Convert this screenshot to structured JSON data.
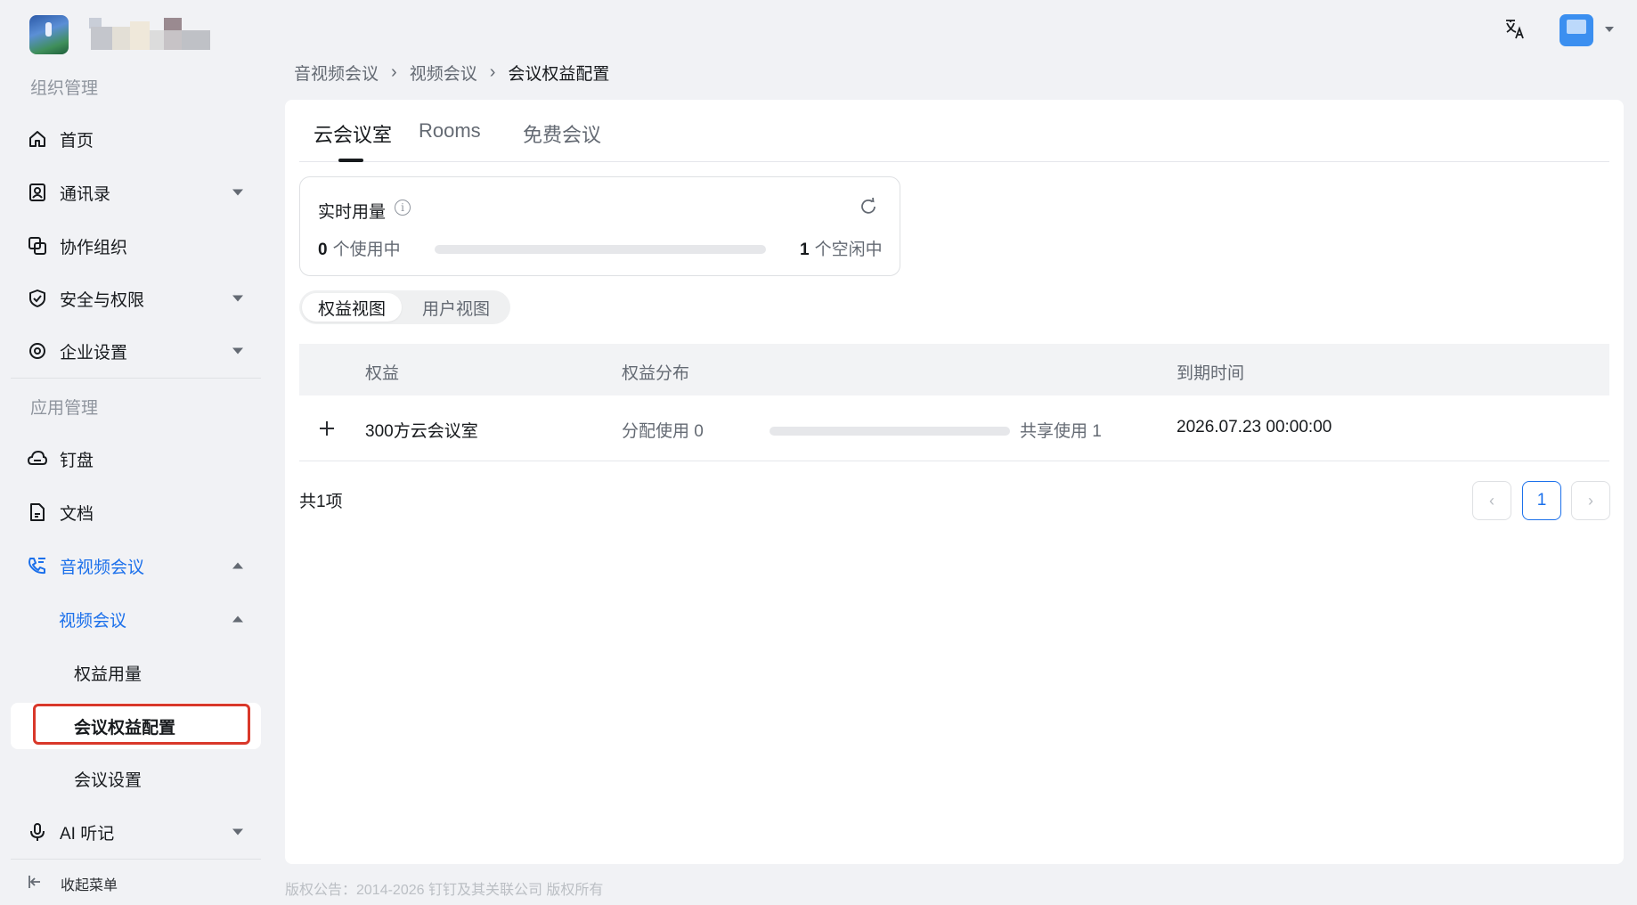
{
  "sidebar": {
    "group_org": "组织管理",
    "group_app": "应用管理",
    "items": [
      {
        "label": "首页"
      },
      {
        "label": "通讯录"
      },
      {
        "label": "协作组织"
      },
      {
        "label": "安全与权限"
      },
      {
        "label": "企业设置"
      },
      {
        "label": "钉盘"
      },
      {
        "label": "文档"
      },
      {
        "label": "音视频会议"
      },
      {
        "label": "视频会议"
      },
      {
        "label": "权益用量"
      },
      {
        "label": "会议权益配置"
      },
      {
        "label": "会议设置"
      },
      {
        "label": "AI 听记"
      }
    ],
    "collapse_label": "收起菜单"
  },
  "breadcrumb": [
    "音视频会议",
    "视频会议",
    "会议权益配置"
  ],
  "tabs": [
    "云会议室",
    "Rooms",
    "免费会议"
  ],
  "usage": {
    "title": "实时用量",
    "in_use_count": "0",
    "in_use_label": "个使用中",
    "idle_count": "1",
    "idle_label": "个空闲中"
  },
  "views": [
    "权益视图",
    "用户视图"
  ],
  "table": {
    "headers": [
      "权益",
      "权益分布",
      "到期时间"
    ],
    "rows": [
      {
        "name": "300方云会议室",
        "assigned": "分配使用 0",
        "shared": "共享使用 1",
        "expire": "2026.07.23 00:00:00"
      }
    ]
  },
  "pagination": {
    "total": "共1项",
    "current_page": "1"
  },
  "footer": "版权公告：2014-2026 钉钉及其关联公司 版权所有",
  "colors": {
    "accent": "#1b70eb",
    "highlight": "#d9382a"
  }
}
